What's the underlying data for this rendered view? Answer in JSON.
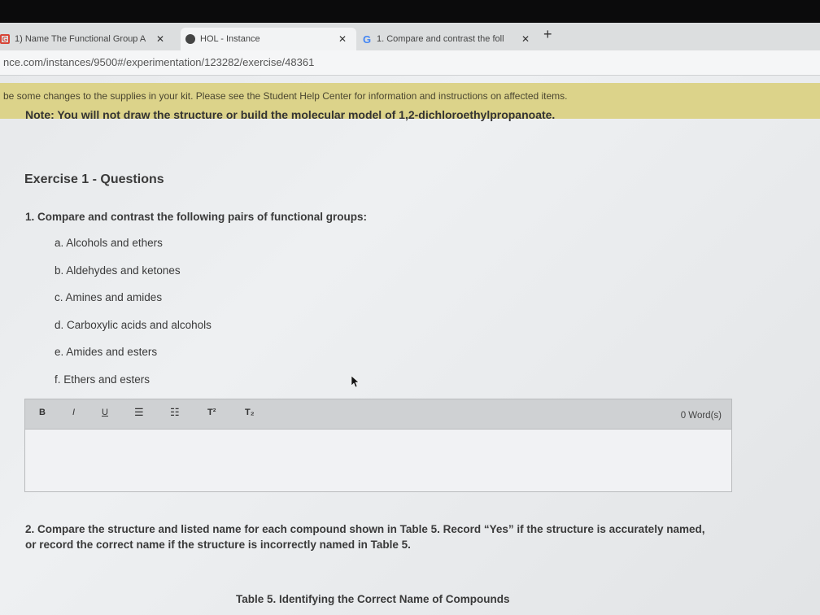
{
  "tabs": [
    {
      "label": "1) Name The Functional Group A",
      "close": "✕",
      "icon": "g-icon"
    },
    {
      "label": "HOL - Instance",
      "close": "✕",
      "icon": "globe-icon"
    },
    {
      "label": "1. Compare and contrast the foll",
      "close": "✕",
      "icon": "google-icon"
    }
  ],
  "new_tab": "+",
  "url": "nce.com/instances/9500#/experimentation/123282/exercise/48361",
  "banner": "be some changes to the supplies in your kit. Please see the Student Help Center for information and instructions on affected items.",
  "note": "Note: You will not draw the structure or build the molecular model of 1,2-dichloroethylpropanoate.",
  "exercise_title": "Exercise 1 - Questions",
  "question1": "1. Compare and contrast the following pairs of functional groups:",
  "options": [
    "a. Alcohols and ethers",
    "b. Aldehydes and ketones",
    "c. Amines and amides",
    "d. Carboxylic acids and alcohols",
    "e. Amides and esters",
    "f. Ethers and esters"
  ],
  "toolbar": {
    "bold": "B",
    "italic": "I",
    "underline": "U",
    "bullets": "☰",
    "numbered": "☷",
    "superscript": "T²",
    "subscript": "T₂"
  },
  "word_count": "0 Word(s)",
  "question2": "2. Compare the structure and listed name for each compound shown in Table 5. Record “Yes” if the structure is accurately named, or record the correct name if the structure is incorrectly named in Table 5.",
  "table_caption": "Table 5. Identifying the Correct Name of Compounds"
}
